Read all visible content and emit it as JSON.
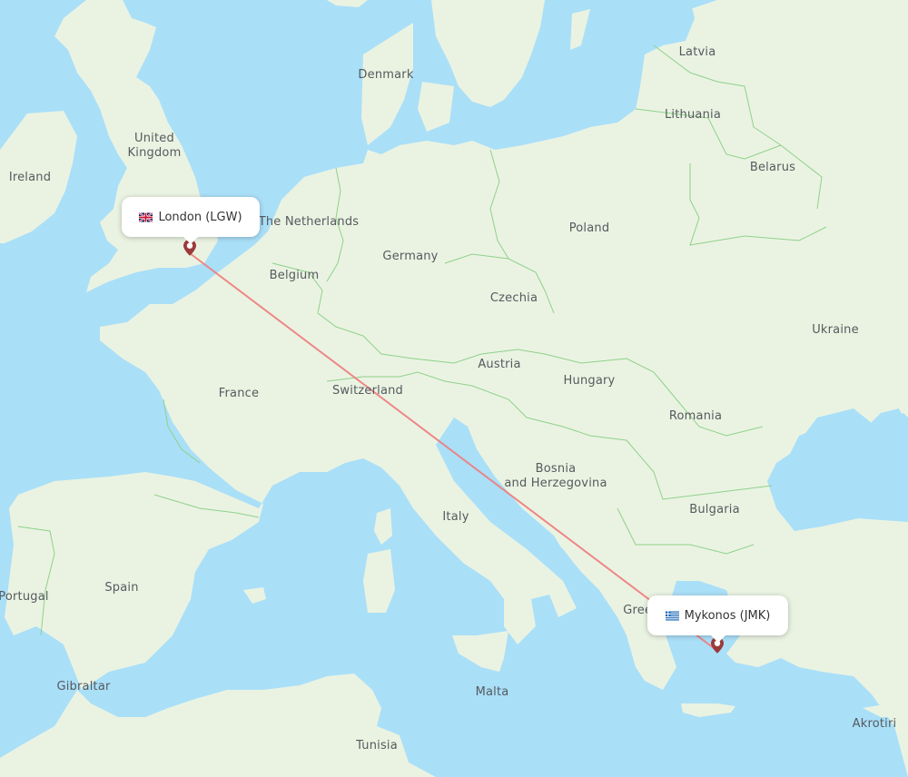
{
  "map": {
    "colors": {
      "water": "#aadff8",
      "land": "#eaf3e2",
      "border": "#8fd18a",
      "route": "#f07b7b",
      "marker": "#9b3a3a"
    },
    "country_labels": [
      {
        "id": "latvia",
        "text": "Latvia"
      },
      {
        "id": "denmark",
        "text": "Denmark"
      },
      {
        "id": "lithuania",
        "text": "Lithuania"
      },
      {
        "id": "united-kingdom",
        "text": "United\nKingdom"
      },
      {
        "id": "belarus",
        "text": "Belarus"
      },
      {
        "id": "ireland",
        "text": "Ireland"
      },
      {
        "id": "netherlands",
        "text": "The Netherlands"
      },
      {
        "id": "poland",
        "text": "Poland"
      },
      {
        "id": "germany",
        "text": "Germany"
      },
      {
        "id": "belgium",
        "text": "Belgium"
      },
      {
        "id": "czechia",
        "text": "Czechia"
      },
      {
        "id": "ukraine",
        "text": "Ukraine"
      },
      {
        "id": "austria",
        "text": "Austria"
      },
      {
        "id": "france",
        "text": "France"
      },
      {
        "id": "hungary",
        "text": "Hungary"
      },
      {
        "id": "switzerland",
        "text": "Switzerland"
      },
      {
        "id": "romania",
        "text": "Romania"
      },
      {
        "id": "bosnia",
        "text": "Bosnia\nand Herzegovina"
      },
      {
        "id": "italy",
        "text": "Italy"
      },
      {
        "id": "bulgaria",
        "text": "Bulgaria"
      },
      {
        "id": "spain",
        "text": "Spain"
      },
      {
        "id": "portugal",
        "text": "Portugal"
      },
      {
        "id": "greece",
        "text": "Greece"
      },
      {
        "id": "gibraltar",
        "text": "Gibraltar"
      },
      {
        "id": "malta",
        "text": "Malta"
      },
      {
        "id": "akrotiri",
        "text": "Akrotiri"
      },
      {
        "id": "tunisia",
        "text": "Tunisia"
      }
    ]
  },
  "route": {
    "origin": {
      "city": "London",
      "code": "LGW",
      "label": "London (LGW)",
      "flag": "gb-flag-icon"
    },
    "destination": {
      "city": "Mykonos",
      "code": "JMK",
      "label": "Mykonos (JMK)",
      "flag": "gr-flag-icon"
    }
  }
}
